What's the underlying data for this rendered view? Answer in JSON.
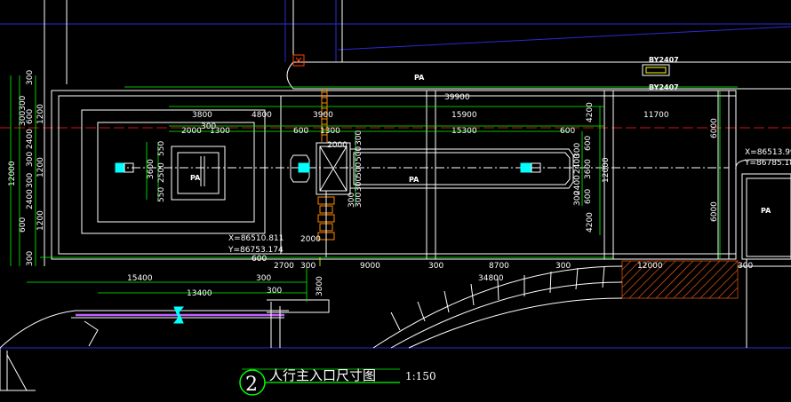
{
  "drawing": {
    "title": "人行主入口尺寸图",
    "number": "2",
    "scale": "1:150"
  },
  "labels": {
    "pa_top": "PA",
    "pa_left": "PA",
    "pa_center": "PA",
    "pa_right": "PA",
    "by_top": "BY2407",
    "by_bottom": "BY2407"
  },
  "coordinates": {
    "left_x": "X=86510.811",
    "left_y": "Y=86753.174",
    "right_x": "X=86513.991",
    "right_y": "Y=86785.181"
  },
  "dims": {
    "top_overall": "39900",
    "top_3800": "3800",
    "top_4800": "4800",
    "top_3900": "3900",
    "top_15900": "15900",
    "top_11700": "11700",
    "top_4200": "4200",
    "r_6000a": "6000",
    "r_6000b": "6000",
    "r2000a": "2000",
    "r300a": "300",
    "r1300": "1300",
    "r600a": "600",
    "r1300b": "1300",
    "r15300": "15300",
    "r600b": "600",
    "r2000b": "2000",
    "v300_top": "300",
    "v300_mid": "300",
    "v2000": "2000",
    "v300c": "300",
    "left_300a": "300",
    "left_300300": "300300",
    "left_600": "600",
    "left_1200": "1200",
    "left_2400a": "2400",
    "left_300b": "300",
    "left_1200b": "1200",
    "left_300c": "300",
    "left_2400b": "2400",
    "left_1200c": "1200",
    "left_600b": "600",
    "left_300d": "300",
    "left_12000": "12000",
    "sq_3600": "3600",
    "sq_550a": "550",
    "sq_2500": "2500",
    "sq_550b": "550",
    "ctr_300a": "300",
    "ctr_2400a": "2400",
    "ctr_3600": "3600",
    "ctr_2400b": "2400",
    "ctr_300b": "300",
    "ctr_12000": "12000",
    "ctr_600a": "600",
    "ctr_600b": "600",
    "ctr_4200": "4200",
    "v_300_500a": "300",
    "v_500a": "500",
    "v_500b": "500",
    "v_300_500b": "300",
    "v_300_500c": "300",
    "v_300_500d": "300",
    "b_2000": "2000",
    "b_600": "600",
    "b_2700": "2700",
    "b_300a": "300",
    "b_9000": "9000",
    "b_300b": "300",
    "b_8700": "8700",
    "b_300c": "300",
    "b_12000": "12000",
    "b_300d": "300",
    "b_15400": "15400",
    "b_300e": "300",
    "b_34800": "34800",
    "b_13400": "13400",
    "b_3800": "3800",
    "b_300f": "300"
  },
  "colors": {
    "line_white": "#ffffff",
    "line_green": "#00ff00",
    "line_blue": "#2a2ad6",
    "line_red": "#d01010",
    "line_yellow": "#ffff00",
    "line_cyan": "#00ffff",
    "line_magenta": "#c060ff",
    "line_orange": "#ff8800",
    "title_circle": "#00ff00"
  }
}
